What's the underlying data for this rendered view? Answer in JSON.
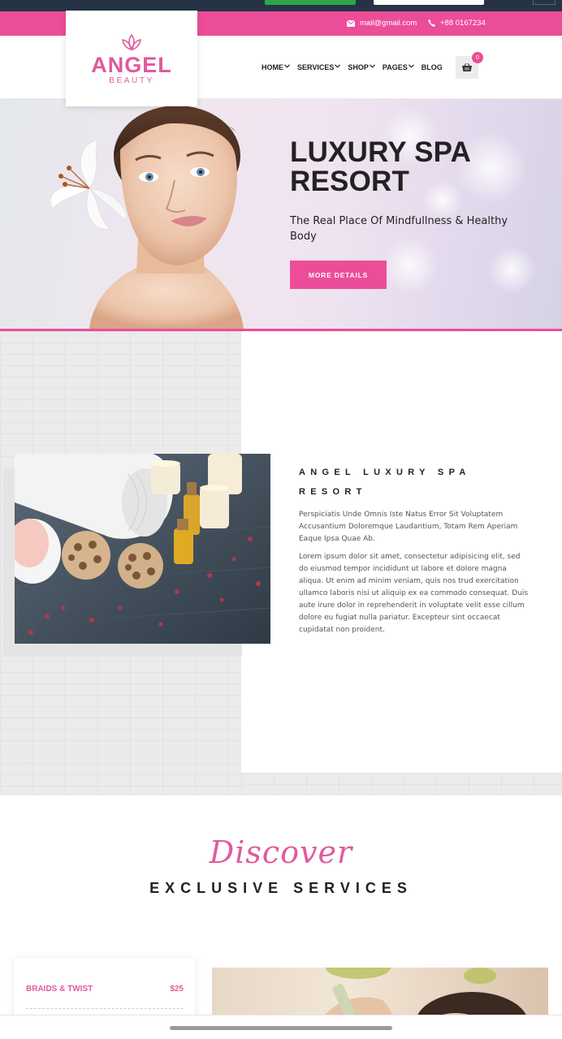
{
  "colors": {
    "accent": "#ec4d98",
    "dark": "#263345",
    "text": "#222222"
  },
  "topbar": {
    "email": "mail@gmail.com",
    "phone": "+88 0167234",
    "email_icon": "envelope-icon",
    "phone_icon": "phone-icon"
  },
  "logo": {
    "main": "ANGEL",
    "sub": "BEAUTY",
    "icon": "lotus-icon"
  },
  "nav": {
    "items": [
      {
        "label": "HOME",
        "dropdown": true
      },
      {
        "label": "SERVICES",
        "dropdown": true
      },
      {
        "label": "SHOP",
        "dropdown": true
      },
      {
        "label": "PAGES",
        "dropdown": true
      },
      {
        "label": "BLOG",
        "dropdown": false
      }
    ],
    "cart_count": "0",
    "cart_icon": "shopping-basket-icon"
  },
  "hero": {
    "title": "LUXURY SPA RESORT",
    "subtitle": "The Real Place Of Mindfullness & Healthy Body",
    "button": "MORE DETAILS"
  },
  "about": {
    "heading": "ANGEL LUXURY SPA RESORT",
    "paragraph1": "Perspiciatis Unde Omnis Iste Natus Error Sit Voluptatem Accusantium Doloremque Laudantium, Totam Rem Aperiam Eaque Ipsa Quae Ab.",
    "paragraph2": "Lorem ipsum dolor sit amet, consectetur adipisicing elit, sed do eiusmod tempor incididunt ut labore et dolore magna aliqua. Ut enim ad minim veniam, quis nos trud exercitation ullamco laboris nisi ut aliquip ex ea commodo consequat. Duis aute irure dolor in reprehenderit in voluptate velit esse cillum dolore eu fugiat nulla pariatur. Excepteur sint occaecat cupidatat non proident."
  },
  "services": {
    "script_title": "Discover",
    "title": "EXCLUSIVE SERVICES",
    "items": [
      {
        "name": "BRAIDS & TWIST",
        "price": "$25"
      }
    ]
  }
}
